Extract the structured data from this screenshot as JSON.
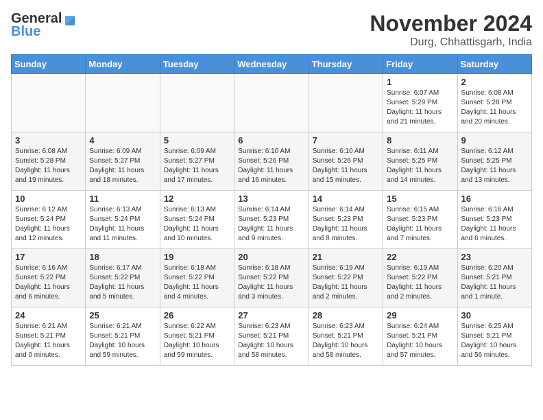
{
  "logo": {
    "general": "General",
    "blue": "Blue"
  },
  "header": {
    "month": "November 2024",
    "location": "Durg, Chhattisgarh, India"
  },
  "days_of_week": [
    "Sunday",
    "Monday",
    "Tuesday",
    "Wednesday",
    "Thursday",
    "Friday",
    "Saturday"
  ],
  "weeks": [
    [
      {
        "day": "",
        "info": ""
      },
      {
        "day": "",
        "info": ""
      },
      {
        "day": "",
        "info": ""
      },
      {
        "day": "",
        "info": ""
      },
      {
        "day": "",
        "info": ""
      },
      {
        "day": "1",
        "info": "Sunrise: 6:07 AM\nSunset: 5:29 PM\nDaylight: 11 hours and 21 minutes."
      },
      {
        "day": "2",
        "info": "Sunrise: 6:08 AM\nSunset: 5:28 PM\nDaylight: 11 hours and 20 minutes."
      }
    ],
    [
      {
        "day": "3",
        "info": "Sunrise: 6:08 AM\nSunset: 5:28 PM\nDaylight: 11 hours and 19 minutes."
      },
      {
        "day": "4",
        "info": "Sunrise: 6:09 AM\nSunset: 5:27 PM\nDaylight: 11 hours and 18 minutes."
      },
      {
        "day": "5",
        "info": "Sunrise: 6:09 AM\nSunset: 5:27 PM\nDaylight: 11 hours and 17 minutes."
      },
      {
        "day": "6",
        "info": "Sunrise: 6:10 AM\nSunset: 5:26 PM\nDaylight: 11 hours and 16 minutes."
      },
      {
        "day": "7",
        "info": "Sunrise: 6:10 AM\nSunset: 5:26 PM\nDaylight: 11 hours and 15 minutes."
      },
      {
        "day": "8",
        "info": "Sunrise: 6:11 AM\nSunset: 5:25 PM\nDaylight: 11 hours and 14 minutes."
      },
      {
        "day": "9",
        "info": "Sunrise: 6:12 AM\nSunset: 5:25 PM\nDaylight: 11 hours and 13 minutes."
      }
    ],
    [
      {
        "day": "10",
        "info": "Sunrise: 6:12 AM\nSunset: 5:24 PM\nDaylight: 11 hours and 12 minutes."
      },
      {
        "day": "11",
        "info": "Sunrise: 6:13 AM\nSunset: 5:24 PM\nDaylight: 11 hours and 11 minutes."
      },
      {
        "day": "12",
        "info": "Sunrise: 6:13 AM\nSunset: 5:24 PM\nDaylight: 11 hours and 10 minutes."
      },
      {
        "day": "13",
        "info": "Sunrise: 6:14 AM\nSunset: 5:23 PM\nDaylight: 11 hours and 9 minutes."
      },
      {
        "day": "14",
        "info": "Sunrise: 6:14 AM\nSunset: 5:23 PM\nDaylight: 11 hours and 8 minutes."
      },
      {
        "day": "15",
        "info": "Sunrise: 6:15 AM\nSunset: 5:23 PM\nDaylight: 11 hours and 7 minutes."
      },
      {
        "day": "16",
        "info": "Sunrise: 6:16 AM\nSunset: 5:23 PM\nDaylight: 11 hours and 6 minutes."
      }
    ],
    [
      {
        "day": "17",
        "info": "Sunrise: 6:16 AM\nSunset: 5:22 PM\nDaylight: 11 hours and 6 minutes."
      },
      {
        "day": "18",
        "info": "Sunrise: 6:17 AM\nSunset: 5:22 PM\nDaylight: 11 hours and 5 minutes."
      },
      {
        "day": "19",
        "info": "Sunrise: 6:18 AM\nSunset: 5:22 PM\nDaylight: 11 hours and 4 minutes."
      },
      {
        "day": "20",
        "info": "Sunrise: 6:18 AM\nSunset: 5:22 PM\nDaylight: 11 hours and 3 minutes."
      },
      {
        "day": "21",
        "info": "Sunrise: 6:19 AM\nSunset: 5:22 PM\nDaylight: 11 hours and 2 minutes."
      },
      {
        "day": "22",
        "info": "Sunrise: 6:19 AM\nSunset: 5:22 PM\nDaylight: 11 hours and 2 minutes."
      },
      {
        "day": "23",
        "info": "Sunrise: 6:20 AM\nSunset: 5:21 PM\nDaylight: 11 hours and 1 minute."
      }
    ],
    [
      {
        "day": "24",
        "info": "Sunrise: 6:21 AM\nSunset: 5:21 PM\nDaylight: 11 hours and 0 minutes."
      },
      {
        "day": "25",
        "info": "Sunrise: 6:21 AM\nSunset: 5:21 PM\nDaylight: 10 hours and 59 minutes."
      },
      {
        "day": "26",
        "info": "Sunrise: 6:22 AM\nSunset: 5:21 PM\nDaylight: 10 hours and 59 minutes."
      },
      {
        "day": "27",
        "info": "Sunrise: 6:23 AM\nSunset: 5:21 PM\nDaylight: 10 hours and 58 minutes."
      },
      {
        "day": "28",
        "info": "Sunrise: 6:23 AM\nSunset: 5:21 PM\nDaylight: 10 hours and 58 minutes."
      },
      {
        "day": "29",
        "info": "Sunrise: 6:24 AM\nSunset: 5:21 PM\nDaylight: 10 hours and 57 minutes."
      },
      {
        "day": "30",
        "info": "Sunrise: 6:25 AM\nSunset: 5:21 PM\nDaylight: 10 hours and 56 minutes."
      }
    ]
  ]
}
